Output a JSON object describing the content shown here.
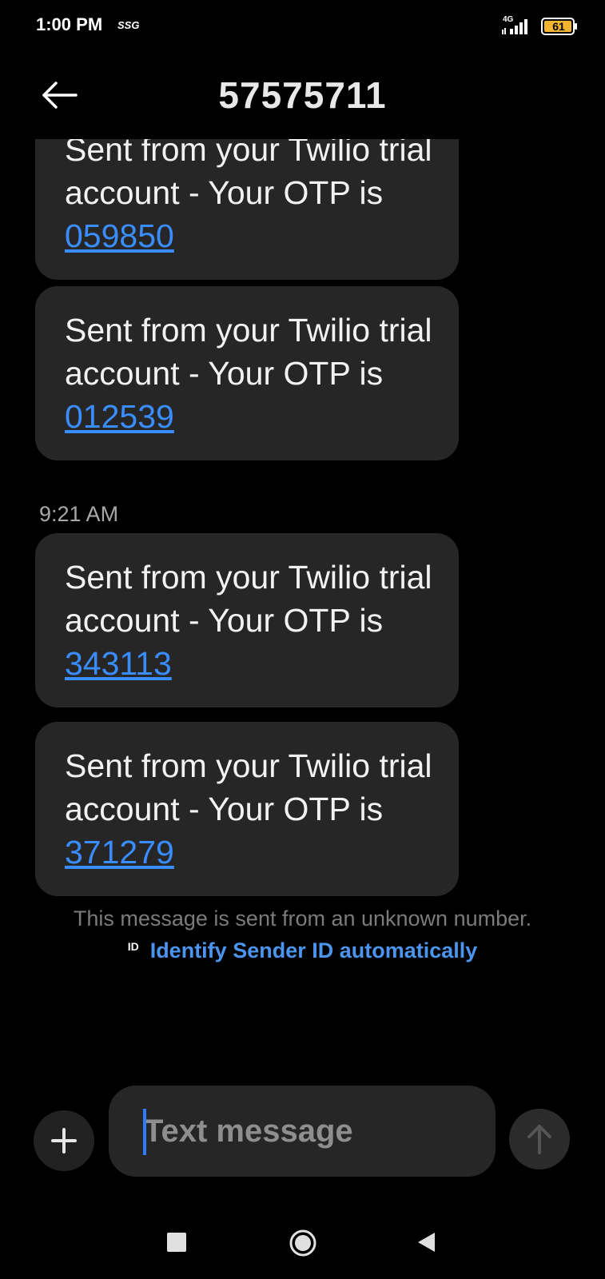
{
  "status_bar": {
    "time": "1:00 PM",
    "carrier_label": "SSG",
    "network_type": "4G",
    "battery_level": "61"
  },
  "header": {
    "contact_number": "57575711"
  },
  "messages": [
    {
      "prefix": "Sent from your Twilio trial account - Your OTP is ",
      "code": "059850"
    },
    {
      "prefix": "Sent from your Twilio trial account - Your OTP is ",
      "code": "012539"
    },
    {
      "prefix": "Sent from your Twilio trial account - Your OTP is ",
      "code": "343113"
    },
    {
      "prefix": "Sent from your Twilio trial account - Your OTP is ",
      "code": "371279"
    }
  ],
  "timestamp": "9:21 AM",
  "notice": {
    "unknown_text": "This message is sent from an unknown number.",
    "id_badge": "ID",
    "identify_link": "Identify Sender ID automatically"
  },
  "composer": {
    "placeholder": "Text message"
  },
  "icons": {
    "back": "arrow-left-icon",
    "add": "plus-icon",
    "send": "arrow-up-icon",
    "recents": "square-icon",
    "home": "circle-icon",
    "nav_back": "triangle-left-icon"
  },
  "colors": {
    "background": "#000000",
    "bubble": "#262626",
    "link": "#3a8dff",
    "identify_link": "#4b95ee",
    "battery": "#f2b431"
  }
}
